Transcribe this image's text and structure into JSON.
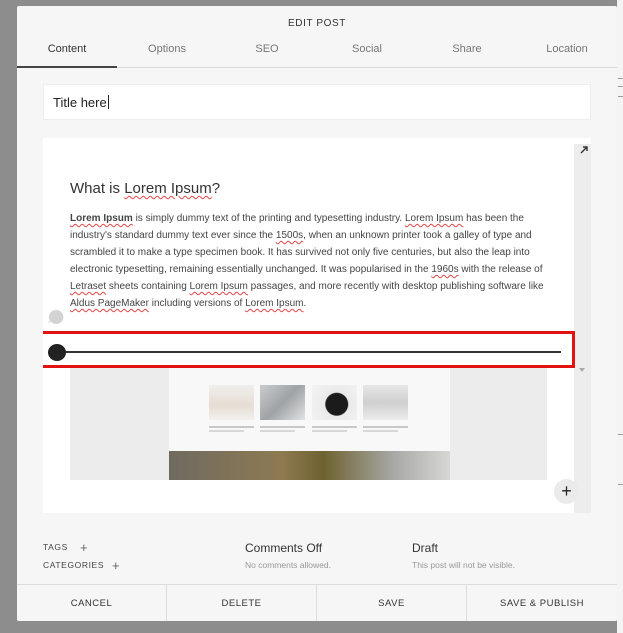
{
  "modal": {
    "title": "EDIT POST"
  },
  "tabs": [
    {
      "label": "Content"
    },
    {
      "label": "Options"
    },
    {
      "label": "SEO"
    },
    {
      "label": "Social"
    },
    {
      "label": "Share"
    },
    {
      "label": "Location"
    }
  ],
  "title_field": {
    "value": "Title here"
  },
  "editor": {
    "heading_prefix": "What is ",
    "heading_link": "Lorem Ipsum",
    "heading_suffix": "?",
    "paragraph": [
      {
        "t": "Lorem Ipsum",
        "sq": true,
        "bold": true
      },
      {
        "t": " is simply dummy text of the printing and typesetting industry. "
      },
      {
        "t": "Lorem Ipsum",
        "sq": true
      },
      {
        "t": " has been the industry's standard dummy text ever since the "
      },
      {
        "t": "1500s",
        "sq": true
      },
      {
        "t": ", when an unknown printer took a galley of type and scrambled it to make a type specimen book. It has survived not only five centuries, but also the leap into electronic typesetting, remaining essentially unchanged. It was popularised in the "
      },
      {
        "t": "1960s",
        "sq": true
      },
      {
        "t": " with the release of "
      },
      {
        "t": "Letraset",
        "sq": true
      },
      {
        "t": " sheets containing "
      },
      {
        "t": "Lorem Ipsum",
        "sq": true
      },
      {
        "t": " passages, and more recently with desktop publishing software like "
      },
      {
        "t": "Aldus PageMaker",
        "sq": true
      },
      {
        "t": " including versions of "
      },
      {
        "t": "Lorem Ipsum",
        "sq": true
      },
      {
        "t": "."
      }
    ],
    "slider_value": 0,
    "add_icon": "plus-icon",
    "expand_icon": "expand-arrow-icon"
  },
  "meta": {
    "tags_label": "TAGS",
    "categories_label": "CATEGORIES",
    "comments_title": "Comments Off",
    "comments_sub": "No comments allowed.",
    "status_title": "Draft",
    "status_sub": "This post will not be visible."
  },
  "footer": {
    "cancel": "CANCEL",
    "delete": "DELETE",
    "save": "SAVE",
    "save_publish": "SAVE & PUBLISH"
  },
  "colors": {
    "highlight": "#e21212",
    "spellcheck": "#e04646",
    "backdrop": "#8d8d8d"
  }
}
